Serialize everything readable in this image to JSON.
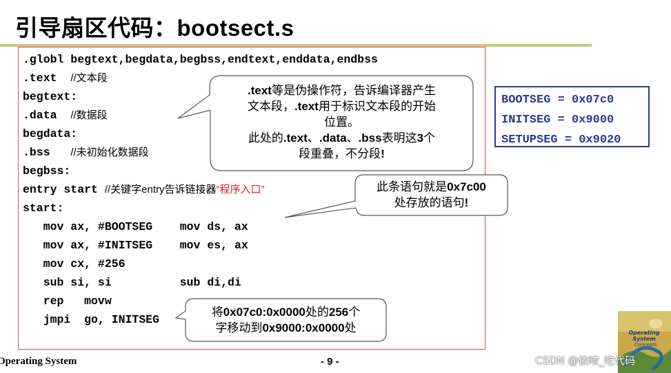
{
  "slide": {
    "title": "引导扇区代码：bootsect.s",
    "page_number": "- 9 -",
    "footer_left": "Operating System"
  },
  "code": {
    "line1": ".globl begtext,begdata,begbss,endtext,enddata,endbss",
    "line2_code": ".text  ",
    "line2_comment": "//文本段",
    "line3": "begtext:",
    "line4_code": ".data  ",
    "line4_comment": "//数据段",
    "line5": "begdata:",
    "line6_code": ".bss   ",
    "line6_comment": "//未初始化数据段",
    "line7": "begbss:",
    "line8_code": "entry start ",
    "line8_comment": "//关键字entry告诉链接器",
    "line8_red": "“程序入口”",
    "line9": "start:",
    "line10": "   mov ax, #BOOTSEG    mov ds, ax",
    "line11": "   mov ax, #INITSEG    mov es, ax",
    "line12": "   mov cx, #256",
    "line13": "   sub si, si          sub di,di",
    "line14": "   rep   movw",
    "line15": "   jmpi  go, INITSEG"
  },
  "callouts": {
    "text_directive": {
      "l1_b1": ".text",
      "l1_rest": "等是伪操作符，告诉编译器产生",
      "l2_a": "文本段，",
      "l2_b": ".text",
      "l2_c": "用于标识文本段的开始",
      "l3": "位置。",
      "l4_a": "此处的",
      "l4_b": ".text",
      "l4_c": "、",
      "l4_d": ".data",
      "l4_e": "、",
      "l4_f": ".bss",
      "l4_g": "表明这",
      "l4_h": "3",
      "l4_i": "个",
      "l5_a": "段重叠，不分段",
      "l5_b": "!"
    },
    "address": {
      "l1_a": "此条语句就是",
      "l1_b": "0x7c00",
      "l2_a": "处存放的语句",
      "l2_b": "!"
    },
    "move": {
      "l1_a": "将",
      "l1_b": "0x07c0:0x0000",
      "l1_c": "处的",
      "l1_d": "256",
      "l1_e": "个",
      "l2_a": "字移动到",
      "l2_b": "0x9000:0x0000",
      "l2_c": "处"
    }
  },
  "segments": {
    "bootseg": "BOOTSEG = 0x07c0",
    "initseg": "INITSEG = 0x9000",
    "setupseg": "SETUPSEG = 0x9020"
  },
  "book_cover": {
    "title_line1": "Operating",
    "title_line2": "System",
    "title_line3": "Concepts"
  },
  "watermark": "CSDN @依哝_吃代码",
  "colors": {
    "code_border": "#e05050",
    "title_rule": "#c6c97a",
    "segment_blue": "#2a3a8c",
    "highlight_red": "#e02020"
  }
}
